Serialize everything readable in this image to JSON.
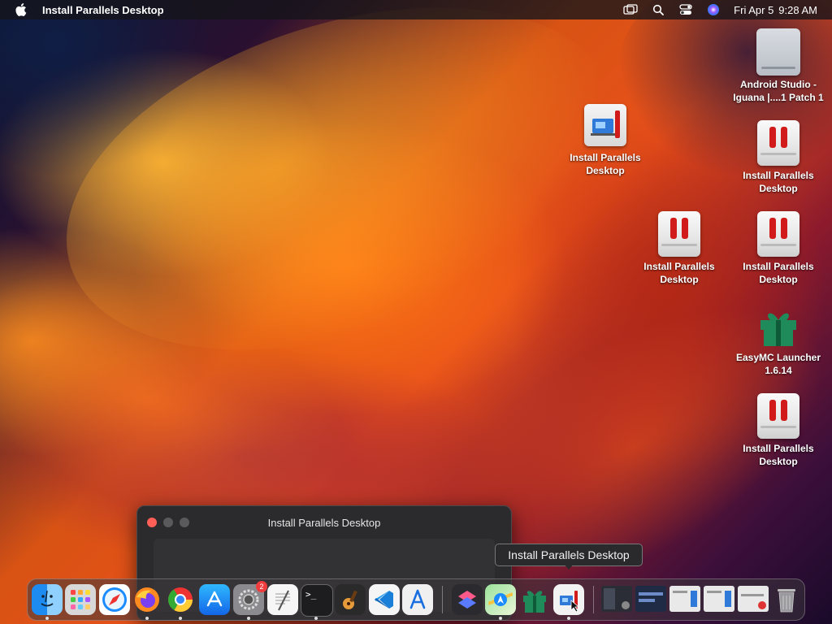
{
  "menubar": {
    "app_name": "Install Parallels Desktop",
    "date": "Fri Apr 5",
    "time": "9:28 AM"
  },
  "desktop": {
    "icons": [
      {
        "label": "Android Studio - Iguana |....1 Patch 1",
        "kind": "drive"
      },
      {
        "label": "Install Parallels Desktop",
        "kind": "dmg"
      },
      {
        "label": "Install Parallels Desktop",
        "kind": "pkg"
      },
      {
        "label": "Install Parallels Desktop",
        "kind": "pkg"
      },
      {
        "label": "Install Parallels Desktop",
        "kind": "pkg"
      },
      {
        "label": "EasyMC Launcher 1.6.14",
        "kind": "gift"
      },
      {
        "label": "Install Parallels Desktop",
        "kind": "pkg"
      }
    ]
  },
  "window": {
    "title": "Install Parallels Desktop"
  },
  "tooltip": {
    "text": "Install Parallels Desktop"
  },
  "dock": {
    "settings_badge": "2"
  }
}
